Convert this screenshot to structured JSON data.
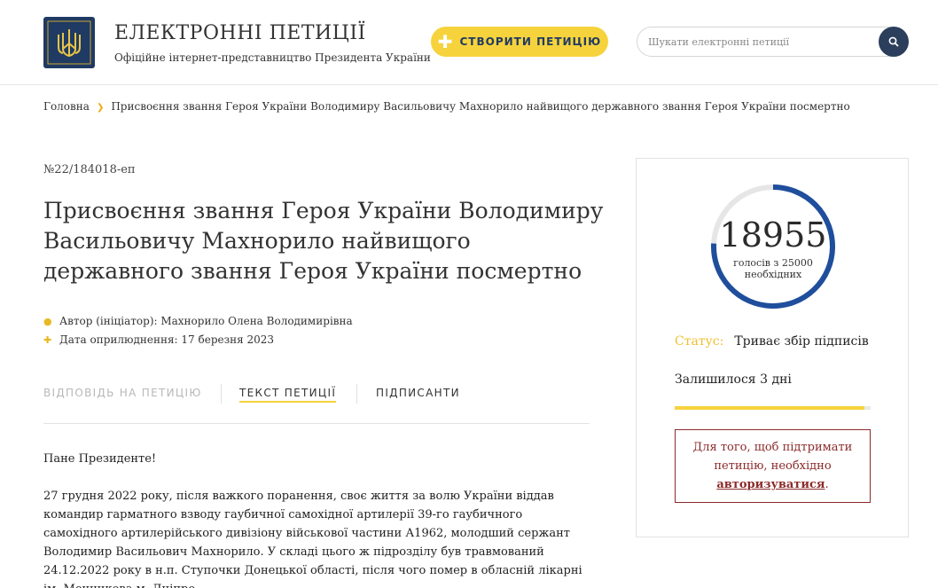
{
  "header": {
    "title": "ЕЛЕКТРОННІ ПЕТИЦІЇ",
    "subtitle": "Офіційне інтернет-представництво Президента України",
    "create_label": "СТВОРИТИ ПЕТИЦІЮ",
    "search_placeholder": "Шукати електронні петиції"
  },
  "breadcrumb": {
    "home": "Головна",
    "current": "Присвоєння звання Героя України Володимиру Васильовичу Махнорило найвищого державного звання Героя України посмертно"
  },
  "petition": {
    "number": "№22/184018-еп",
    "title": "Присвоєння звання Героя України Володимиру Васильовичу Махнорило найвищого державного звання Героя України посмертно",
    "author": "Автор (ініціатор): Махнорило Олена Володимирівна",
    "date": "Дата оприлюднення: 17 березня 2023",
    "tabs": [
      "ВІДПОВІДЬ НА ПЕТИЦІЮ",
      "ТЕКСТ ПЕТИЦІЇ",
      "ПІДПИСАНТИ"
    ],
    "greeting": "Пане Президенте!",
    "paragraph": "27 грудня 2022 року, після важкого поранення, своє життя за волю України віддав командир гарматного взводу гаубичної самохідної артилерії 39-го гаубичного самохідного артилерійського дивізіону військової частини А1962, молодший сержант Володимир Васильович Махнорило. У складі цього ж підрозділу був травмований 24.12.2022 року в н.п. Ступочки Донецької області, після чого помер в обласній лікарні ім. Мечникова м. Дніпро."
  },
  "sidebar": {
    "count": "18955",
    "count_sub": "голосів з 25000 необхідних",
    "votes": 18955,
    "goal": 25000,
    "status_label": "Статус:",
    "status_value": "Триває збір підписів",
    "remaining": "Залишилося 3 дні",
    "progress": 0.97,
    "auth_text": "Для того, щоб підтримати петицію, необхідно",
    "auth_link": "авторизуватися",
    "auth_end": "."
  },
  "colors": {
    "accent": "#f6d33c",
    "navy": "#1f3a63",
    "ring": "#1f4e9c",
    "alert": "#8b2a2a"
  }
}
